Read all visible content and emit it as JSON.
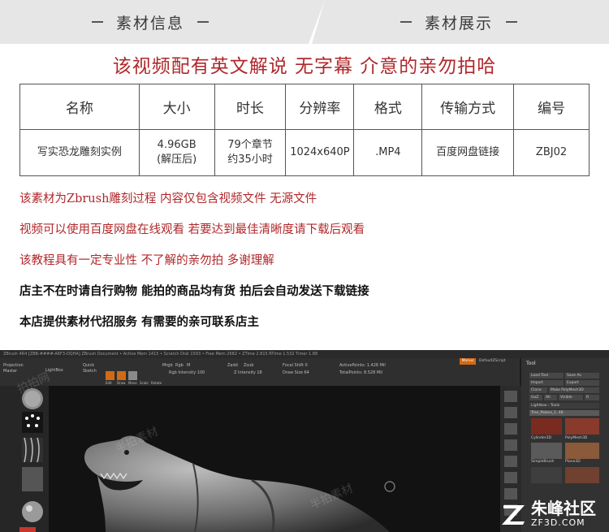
{
  "header": {
    "left_title": "素材信息",
    "right_title": "素材展示"
  },
  "headline": "该视频配有英文解说 无字幕 介意的亲勿拍哈",
  "table": {
    "headers": [
      "名称",
      "大小",
      "时长",
      "分辨率",
      "格式",
      "传输方式",
      "编号"
    ],
    "row": {
      "name": "写实恐龙雕刻实例",
      "size_line1": "4.96GB",
      "size_line2": "(解压后)",
      "duration_line1": "79个章节",
      "duration_line2": "约35小时",
      "resolution": "1024x640P",
      "format": ".MP4",
      "transfer": "百度网盘链接",
      "code": "ZBJ02"
    }
  },
  "notes": [
    "该素材为Zbrush雕刻过程 内容仅包含视频文件 无源文件",
    "视频可以使用百度网盘在线观看 若要达到最佳清晰度请下载后观看",
    "该教程具有一定专业性 不了解的亲勿拍 多谢理解",
    "店主不在时请自行购物 能拍的商品均有货 拍后会自动发送下载链接",
    "本店提供素材代招服务 有需要的亲可联系店主"
  ],
  "preview": {
    "app_menu": "ZBrush 4R4 [ZBB-####-A6F3-DQHA]   ZBrush Document   • Active Mem 1415 • Scratch Disk 1593 • Free Mem 2682 • ZTime 2.815 RTime 1.532 Timer 1.88",
    "menu_items": "Alpha  Brush  Color  Document  Draw  Edit  File  Layer  Light  Macro  Marker  Material  Movie  Picture  Preferences  Render  Stencil  Stroke  Texture  Tool  Transform  Zplugin  Zscript",
    "toolbar_items": [
      "Projection Master",
      "LightBox",
      "Quick Sketch",
      "Edit",
      "Draw",
      "Move",
      "Scale",
      "Rotate"
    ],
    "toolbar_params": [
      "Mrgb",
      "Rgb",
      "M",
      "Rgb Intensity 100",
      "Zadd",
      "Zsub",
      "Z Intensity 18",
      "Focal Shift 0",
      "Draw Size 64",
      "ActivePoints: 1.426 Mil",
      "TotalPoints: 8.528 Mil"
    ],
    "menus_btn": "Menus",
    "script_label": "DefaultZScript",
    "panel": {
      "title": "Tool",
      "buttons": [
        "Load Tool",
        "Save As",
        "Import",
        "Export",
        "Clone",
        "Make PolyMesh3D",
        "GoZ",
        "All",
        "Visible",
        "R",
        "Lightbox › Tools",
        "Trex_Palace_1. 48"
      ],
      "thumbs": [
        "Cylinder3D",
        "PolyMesh3D",
        "SimpleBrush",
        "Plane3D"
      ]
    },
    "watermarks": [
      "拍拍网",
      "半拍素材",
      "半拍素材"
    ],
    "brand": "朱峰社区",
    "brand_url": "ZF3D.COM"
  },
  "colors": {
    "accent_red": "#b0282b",
    "header_gray": "#e6e6e6",
    "zbrush_orange": "#d06a16"
  }
}
